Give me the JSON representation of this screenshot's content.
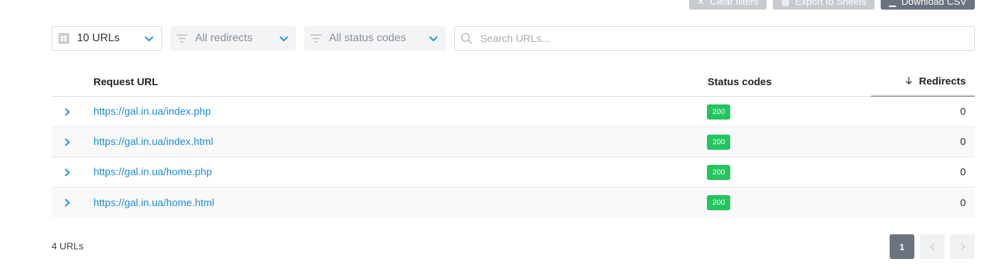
{
  "top_actions": {
    "clear_filters": "Clear filters",
    "export_sheets": "Export to Sheets",
    "download_csv": "Download CSV"
  },
  "filters": {
    "limit_value": "10 URLs",
    "redirects_value": "All redirects",
    "status_value": "All status codes",
    "search_placeholder": "Search URLs..."
  },
  "table": {
    "headers": {
      "url": "Request URL",
      "status": "Status codes",
      "redirects": "Redirects"
    },
    "rows": [
      {
        "url": "https://gal.in.ua/index.php",
        "status": "200",
        "redirects": "0"
      },
      {
        "url": "https://gal.in.ua/index.html",
        "status": "200",
        "redirects": "0"
      },
      {
        "url": "https://gal.in.ua/home.php",
        "status": "200",
        "redirects": "0"
      },
      {
        "url": "https://gal.in.ua/home.html",
        "status": "200",
        "redirects": "0"
      }
    ]
  },
  "footer": {
    "count": "4 URLs",
    "current_page": "1"
  },
  "colors": {
    "link": "#1a8fd8",
    "status_ok": "#22c55e",
    "active_page": "#6b7380",
    "chevron": "#1a8fd8"
  },
  "icons": {
    "limit": "hash-icon",
    "filter": "filter-lines-icon",
    "dropdown": "chevron-down-icon",
    "search": "search-icon",
    "sort": "arrow-down-icon",
    "expand": "chevron-right-icon",
    "prev": "chevron-left-icon",
    "next": "chevron-right-icon"
  }
}
